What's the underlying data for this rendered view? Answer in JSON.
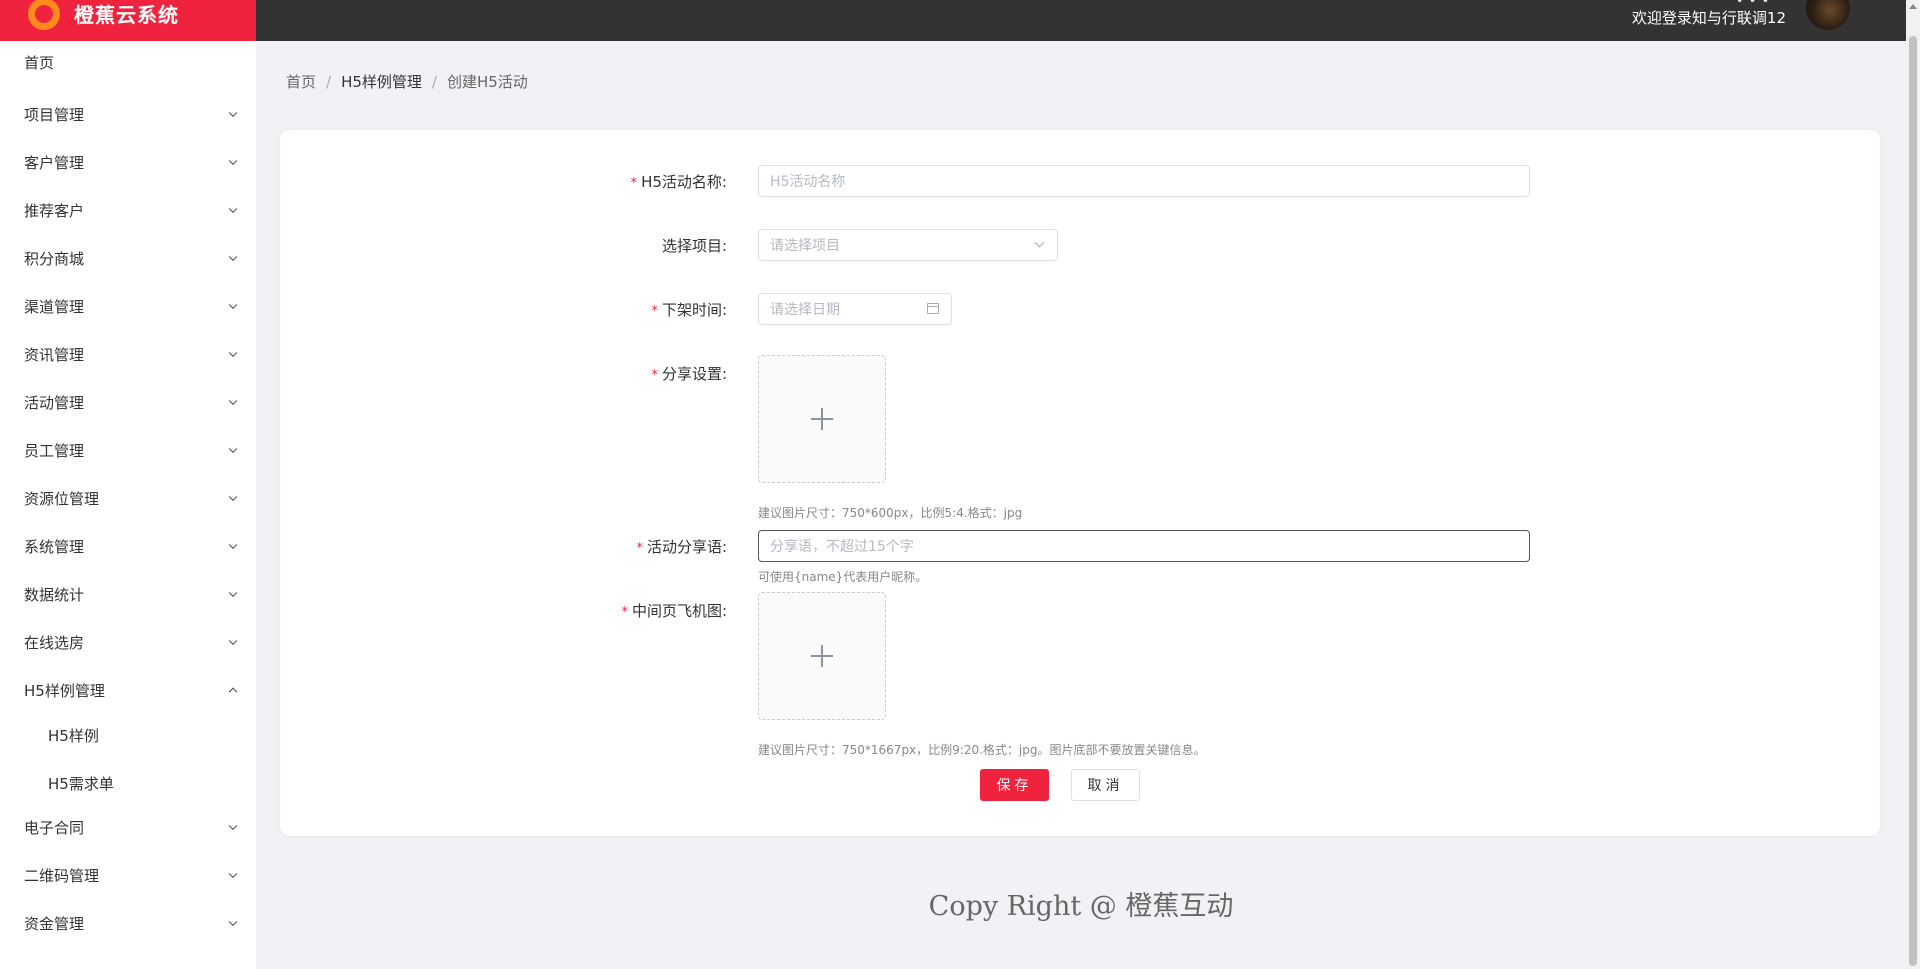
{
  "app": {
    "name": "橙蕉云系统",
    "welcome": "欢迎登录知与行联调12",
    "top_dots": "• • •"
  },
  "colors": {
    "brand": "#f0233f",
    "logo_ring": "#ff8a1f",
    "topbar": "#333333"
  },
  "sidebar": {
    "items": [
      {
        "label": "首页",
        "chevron": "none"
      },
      {
        "label": "项目管理",
        "chevron": "down"
      },
      {
        "label": "客户管理",
        "chevron": "down"
      },
      {
        "label": "推荐客户",
        "chevron": "down"
      },
      {
        "label": "积分商城",
        "chevron": "down"
      },
      {
        "label": "渠道管理",
        "chevron": "down"
      },
      {
        "label": "资讯管理",
        "chevron": "down"
      },
      {
        "label": "活动管理",
        "chevron": "down"
      },
      {
        "label": "员工管理",
        "chevron": "down"
      },
      {
        "label": "资源位管理",
        "chevron": "down"
      },
      {
        "label": "系统管理",
        "chevron": "down"
      },
      {
        "label": "数据统计",
        "chevron": "down"
      },
      {
        "label": "在线选房",
        "chevron": "down"
      },
      {
        "label": "H5样例管理",
        "chevron": "up"
      },
      {
        "label": "H5样例",
        "chevron": "none"
      },
      {
        "label": "H5需求单",
        "chevron": "none"
      },
      {
        "label": "电子合同",
        "chevron": "down"
      },
      {
        "label": "二维码管理",
        "chevron": "down"
      },
      {
        "label": "资金管理",
        "chevron": "down"
      }
    ]
  },
  "breadcrumb": {
    "home": "首页",
    "section": "H5样例管理",
    "current": "创建H5活动",
    "separator": "/"
  },
  "form": {
    "required_mark": "*",
    "name": {
      "label": "H5活动名称:",
      "placeholder": "H5活动名称"
    },
    "project": {
      "label": "选择项目:",
      "placeholder": "请选择项目"
    },
    "offline_time": {
      "label": "下架时间:",
      "placeholder": "请选择日期"
    },
    "share": {
      "label": "分享设置:",
      "hint": "建议图片尺寸：750*600px，比例5:4.格式：jpg"
    },
    "share_text": {
      "label": "活动分享语:",
      "placeholder": "分享语，不超过15个字",
      "hint": "可使用{name}代表用户昵称。"
    },
    "middle_image": {
      "label": "中间页飞机图:",
      "hint": "建议图片尺寸：750*1667px，比例9:20.格式：jpg。图片底部不要放置关键信息。"
    }
  },
  "buttons": {
    "save": "保存",
    "cancel": "取消"
  },
  "footer": {
    "text": "Copy Right @ 橙蕉互动"
  },
  "icons": [
    "logo-ring-icon",
    "chevron-down-icon",
    "chevron-up-icon",
    "select-arrow-icon",
    "calendar-icon",
    "plus-icon",
    "avatar"
  ]
}
